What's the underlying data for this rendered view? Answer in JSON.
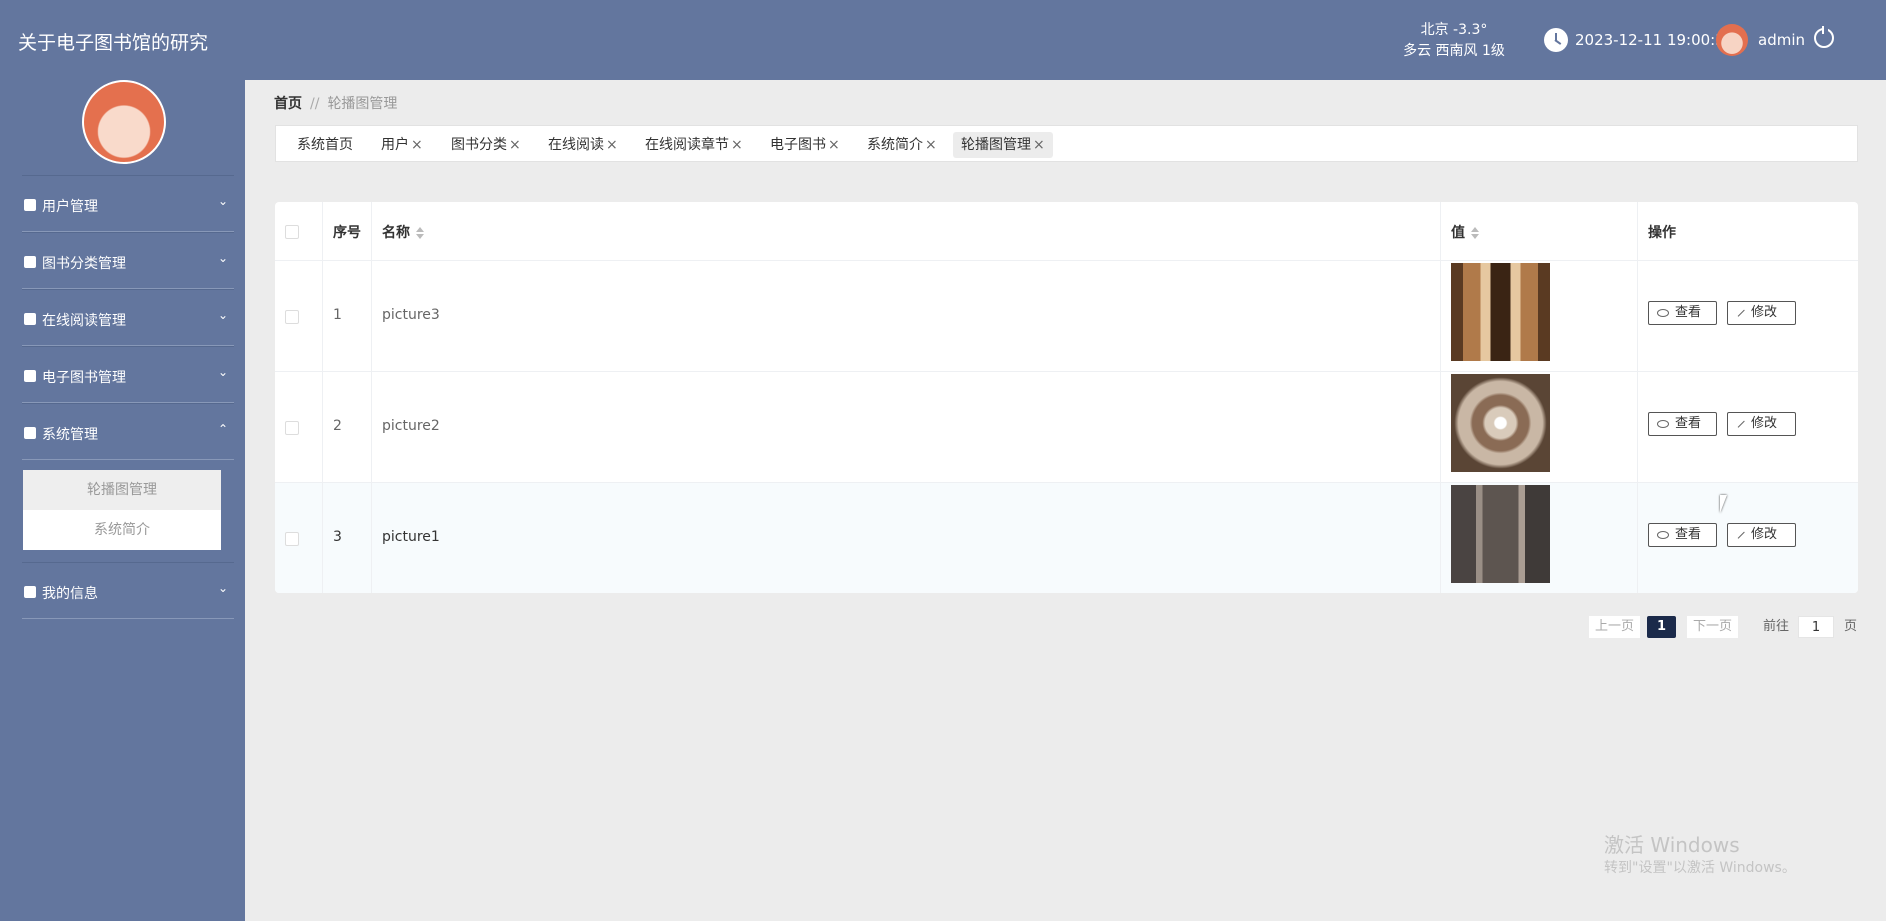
{
  "app": {
    "title": "关于电子图书馆的研究"
  },
  "header": {
    "weather_city": "北京  -3.3°",
    "weather_desc": "多云  西南风  1级",
    "datetime": "2023-12-11 19:00:33",
    "username": "admin"
  },
  "sidebar": {
    "items": [
      {
        "label": "用户管理",
        "icon": "user-icon"
      },
      {
        "label": "图书分类管理",
        "icon": "briefcase-icon"
      },
      {
        "label": "在线阅读管理",
        "icon": "send-icon"
      },
      {
        "label": "电子图书管理",
        "icon": "clipboard-icon"
      },
      {
        "label": "系统管理",
        "icon": "monitor-icon"
      },
      {
        "label": "我的信息",
        "icon": "card-icon"
      }
    ],
    "submenu": [
      {
        "label": "轮播图管理"
      },
      {
        "label": "系统简介"
      }
    ]
  },
  "breadcrumb": {
    "home": "首页",
    "sep": "//",
    "current": "轮播图管理"
  },
  "tabs": [
    {
      "label": "系统首页"
    },
    {
      "label": "用户"
    },
    {
      "label": "图书分类"
    },
    {
      "label": "在线阅读"
    },
    {
      "label": "在线阅读章节"
    },
    {
      "label": "电子图书"
    },
    {
      "label": "系统简介"
    },
    {
      "label": "轮播图管理"
    }
  ],
  "tab_close": "×",
  "table": {
    "headers": {
      "index": "序号",
      "name": "名称",
      "value": "值",
      "actions": "操作"
    },
    "rows": [
      {
        "index": "1",
        "name": "picture3"
      },
      {
        "index": "2",
        "name": "picture2"
      },
      {
        "index": "3",
        "name": "picture1"
      }
    ],
    "view_label": "查看",
    "edit_label": "修改"
  },
  "pagination": {
    "prev": "上一页",
    "page": "1",
    "next": "下一页",
    "goto": "前往",
    "goto_value": "1",
    "unit": "页"
  },
  "watermark": {
    "line1": "激活 Windows",
    "line2": "转到\"设置\"以激活 Windows。"
  },
  "colors": {
    "header_bg": "#63769e",
    "page_bg": "#ececec",
    "active_page": "#1b2a4a"
  }
}
